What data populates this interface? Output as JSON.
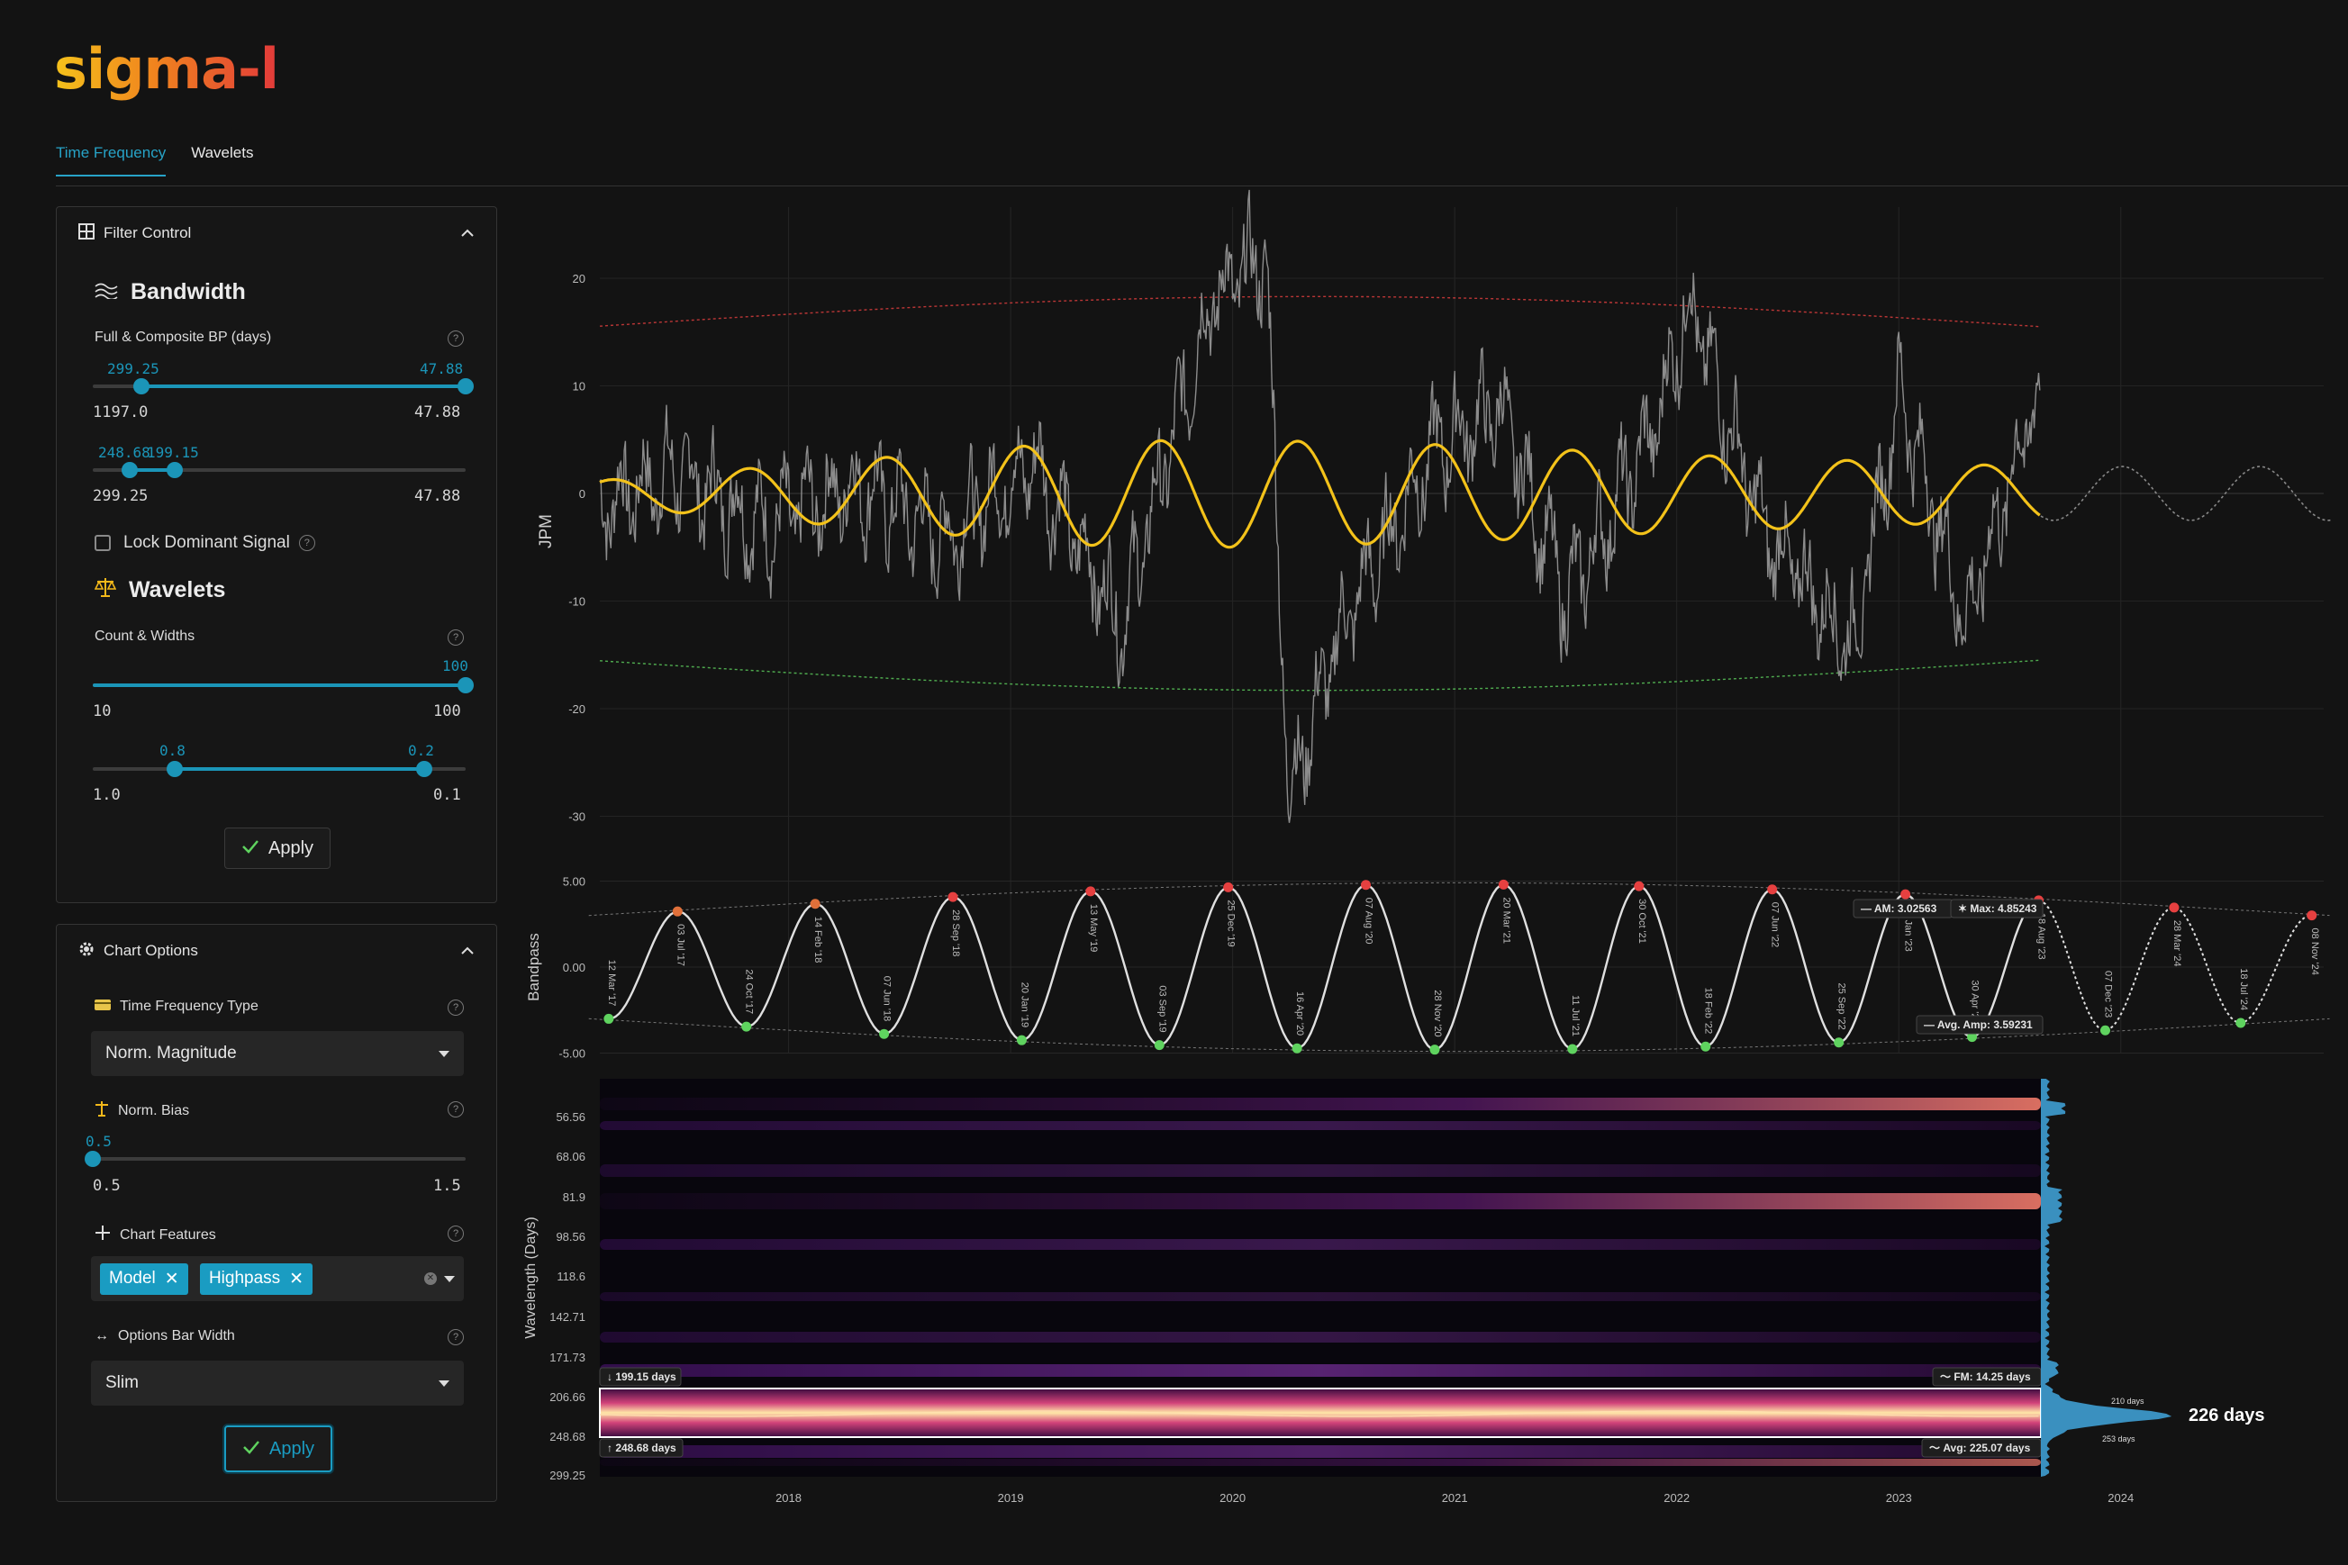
{
  "app": {
    "logo": "sigma-l"
  },
  "tabs": [
    {
      "label": "Time Frequency",
      "active": true
    },
    {
      "label": "Wavelets",
      "active": false
    }
  ],
  "filter": {
    "title": "Filter Control",
    "bandwidth_title": "Bandwidth",
    "bp_label": "Full & Composite BP (days)",
    "bp_slider1": {
      "left_val": "299.25",
      "right_val": "47.88",
      "min": "1197.0",
      "max": "47.88"
    },
    "bp_slider2": {
      "left_val": "248.68",
      "right_val": "199.15",
      "min": "299.25",
      "max": "47.88"
    },
    "lock_label": "Lock Dominant Signal",
    "wavelets_title": "Wavelets",
    "count_label": "Count & Widths",
    "count_slider": {
      "val": "100",
      "min": "10",
      "max": "100"
    },
    "width_slider": {
      "left_val": "0.8",
      "right_val": "0.2",
      "min": "1.0",
      "max": "0.1"
    },
    "apply": "Apply"
  },
  "chart_options": {
    "title": "Chart Options",
    "tf_type_label": "Time Frequency Type",
    "tf_type_value": "Norm. Magnitude",
    "bias_label": "Norm. Bias",
    "bias_slider": {
      "val": "0.5",
      "min": "0.5",
      "max": "1.5"
    },
    "features_label": "Chart Features",
    "features": [
      "Model",
      "Highpass"
    ],
    "bar_width_label": "Options Bar Width",
    "bar_width_value": "Slim",
    "apply": "Apply"
  },
  "colors": {
    "accent": "#1b95b8",
    "model": "#f3c21a",
    "price": "#8c8c8c",
    "peak": "#e64040",
    "trough": "#5fd35f"
  },
  "chart_data": [
    {
      "type": "line",
      "ylabel": "JPM",
      "ylim": [
        -30,
        25
      ],
      "yticks": [
        "20",
        "10",
        "0",
        "-10",
        "-20",
        "-30"
      ],
      "x_range": [
        "2017-02",
        "2024-10"
      ],
      "series": [
        {
          "values_note": "",
          "points": [
            [
              2017.15,
              -1
            ],
            [
              2017.5,
              2
            ],
            [
              2017.9,
              -3
            ],
            [
              2018.3,
              1
            ],
            [
              2018.7,
              -4
            ],
            [
              2019.1,
              3
            ],
            [
              2019.5,
              -12
            ],
            [
              2019.9,
              18
            ],
            [
              2020.15,
              22
            ],
            [
              2020.25,
              -28
            ],
            [
              2020.5,
              -12
            ],
            [
              2020.9,
              4
            ],
            [
              2021.2,
              8
            ],
            [
              2021.5,
              -10
            ],
            [
              2021.9,
              6
            ],
            [
              2022.05,
              18
            ],
            [
              2022.4,
              -4
            ],
            [
              2022.8,
              -14
            ],
            [
              2023.0,
              10
            ],
            [
              2023.3,
              -12
            ],
            [
              2023.6,
              8
            ]
          ]
        },
        {
          "model": true,
          "amplitude_envelope": [
            [
              2017.15,
              1.2
            ],
            [
              2019.3,
              4.8
            ],
            [
              2020.0,
              5.0
            ],
            [
              2021.0,
              4.5
            ],
            [
              2022.0,
              3.6
            ],
            [
              2023.6,
              2.5
            ]
          ],
          "period_days": 226
        }
      ],
      "upper_envelope": [
        [
          2017.15,
          15.5
        ],
        [
          2020.0,
          18.3
        ],
        [
          2023.6,
          15.6
        ]
      ],
      "lower_envelope": [
        [
          2017.15,
          -15.5
        ],
        [
          2020.0,
          -18.3
        ],
        [
          2023.6,
          -15.6
        ]
      ]
    },
    {
      "type": "line",
      "ylabel": "Bandpass",
      "yticks": [
        "5.00",
        "0.00",
        "-5.00"
      ],
      "ylim": [
        -5.5,
        5.5
      ],
      "annotations": {
        "am": "AM: 3.02563",
        "max": "Max: 4.85243",
        "avg_amp": "Avg. Amp: 3.59231"
      },
      "labels": [
        {
          "t": "12 Mar '17",
          "x": 2017.19,
          "kind": "trough"
        },
        {
          "t": "03 Jul '17",
          "x": 2017.5,
          "kind": "peak"
        },
        {
          "t": "24 Oct '17",
          "x": 2017.81,
          "kind": "trough"
        },
        {
          "t": "14 Feb '18",
          "x": 2018.12,
          "kind": "peak"
        },
        {
          "t": "07 Jun '18",
          "x": 2018.43,
          "kind": "trough"
        },
        {
          "t": "28 Sep '18",
          "x": 2018.74,
          "kind": "peak"
        },
        {
          "t": "20 Jan '19",
          "x": 2019.05,
          "kind": "trough"
        },
        {
          "t": "13 May '19",
          "x": 2019.36,
          "kind": "peak"
        },
        {
          "t": "03 Sep '19",
          "x": 2019.67,
          "kind": "trough"
        },
        {
          "t": "25 Dec '19",
          "x": 2019.98,
          "kind": "peak"
        },
        {
          "t": "16 Apr '20",
          "x": 2020.29,
          "kind": "trough"
        },
        {
          "t": "07 Aug '20",
          "x": 2020.6,
          "kind": "peak"
        },
        {
          "t": "28 Nov '20",
          "x": 2020.91,
          "kind": "trough"
        },
        {
          "t": "20 Mar '21",
          "x": 2021.22,
          "kind": "peak"
        },
        {
          "t": "11 Jul '21",
          "x": 2021.53,
          "kind": "trough"
        },
        {
          "t": "30 Oct '21",
          "x": 2021.83,
          "kind": "peak"
        },
        {
          "t": "18 Feb '22",
          "x": 2022.13,
          "kind": "trough"
        },
        {
          "t": "07 Jun '22",
          "x": 2022.43,
          "kind": "peak"
        },
        {
          "t": "25 Sep '22",
          "x": 2022.73,
          "kind": "trough"
        },
        {
          "t": "11 Jan '23",
          "x": 2023.03,
          "kind": "peak"
        },
        {
          "t": "30 Apr '23",
          "x": 2023.33,
          "kind": "trough"
        },
        {
          "t": "18 Aug '23",
          "x": 2023.63,
          "kind": "peak"
        },
        {
          "t": "07 Dec '23",
          "x": 2023.93,
          "kind": "trough"
        },
        {
          "t": "28 Mar '24",
          "x": 2024.24,
          "kind": "peak"
        },
        {
          "t": "18 Jul '24",
          "x": 2024.54,
          "kind": "trough"
        },
        {
          "t": "08 Nov '24",
          "x": 2024.86,
          "kind": "peak"
        }
      ]
    },
    {
      "type": "heatmap",
      "ylabel": "Wavelength (Days)",
      "yticks": [
        "56.56",
        "68.06",
        "81.9",
        "98.56",
        "118.6",
        "142.71",
        "171.73",
        "206.66",
        "248.68",
        "299.25"
      ],
      "xticks": [
        "2018",
        "2019",
        "2020",
        "2021",
        "2022",
        "2023",
        "2024"
      ],
      "band": {
        "low": "↓ 199.15 days",
        "high": "↑ 248.68 days",
        "fm": "〜 FM: 14.25 days",
        "avg": "〜 Avg: 225.07 days"
      },
      "dominant": "226 days",
      "side_labels": [
        "210 days",
        "253 days"
      ]
    }
  ]
}
